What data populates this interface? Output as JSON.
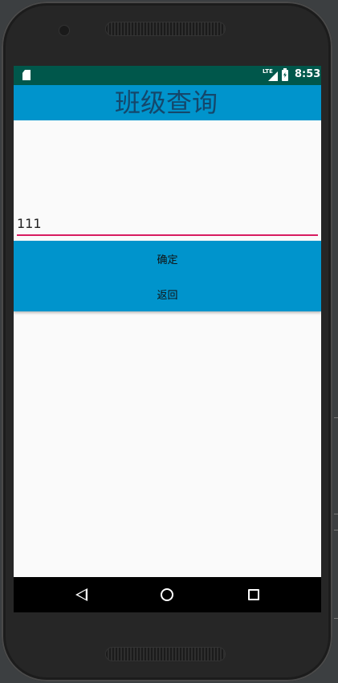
{
  "status_bar": {
    "network_label": "LTE",
    "time": "8:53",
    "icons": [
      "sd-card-icon",
      "signal-icon",
      "battery-charging-icon"
    ]
  },
  "app": {
    "title": "班级查询"
  },
  "form": {
    "input_value": "111",
    "input_placeholder": ""
  },
  "buttons": {
    "confirm_label": "确定",
    "back_label": "返回"
  },
  "navigation": {
    "icons": [
      "back-icon",
      "home-icon",
      "recents-icon"
    ]
  },
  "colors": {
    "status_bar": "#00574b",
    "accent": "#0094cc",
    "title_text": "#14476b",
    "input_underline": "#d81b60",
    "nav_bar": "#000000"
  }
}
